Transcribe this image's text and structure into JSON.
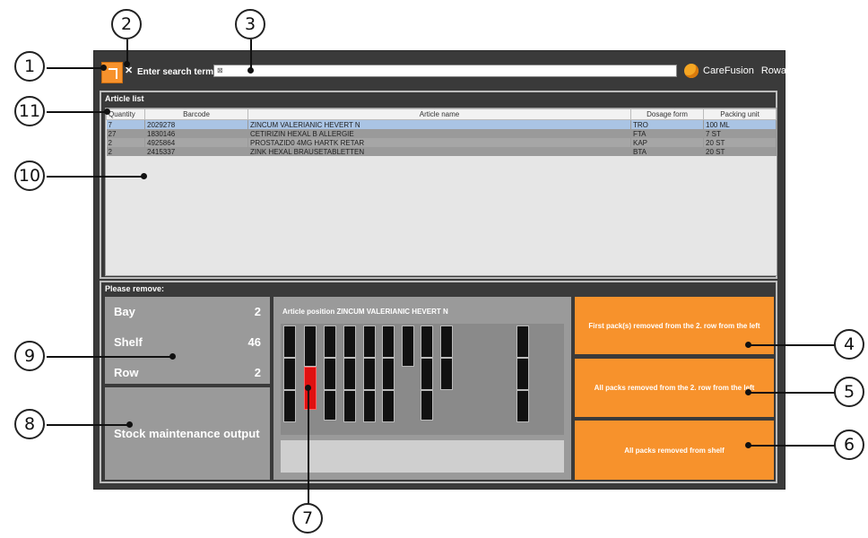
{
  "callouts": [
    "1",
    "2",
    "3",
    "4",
    "5",
    "6",
    "7",
    "8",
    "9",
    "10",
    "11"
  ],
  "toolbar": {
    "close_label": "✕",
    "search_label": "Enter search term:",
    "search_value": "⊠",
    "brand_name": "CareFusion",
    "brand_sub": "Rowa"
  },
  "article_list": {
    "title": "Article list",
    "columns": [
      "Quantity",
      "Barcode",
      "Article name",
      "Dosage form",
      "Packing unit"
    ],
    "rows": [
      [
        "7",
        "2029278",
        "ZINCUM VALERIANIC HEVERT N",
        "TRO",
        "100 ML"
      ],
      [
        "27",
        "1830146",
        "CETIRIZIN HEXAL B ALLERGIE",
        "FTA",
        "7 ST"
      ],
      [
        "2",
        "4925864",
        "PROSTAZID0 4MG HARTK RETAR",
        "KAP",
        "20 ST"
      ],
      [
        "2",
        "2415337",
        "ZINK HEXAL BRAUSETABLETTEN",
        "BTA",
        "20 ST"
      ]
    ]
  },
  "removal": {
    "title": "Please remove:",
    "bay_label": "Bay",
    "bay_value": "2",
    "shelf_label": "Shelf",
    "shelf_value": "46",
    "row_label": "Row",
    "row_value": "2",
    "stock_button": "Stock maintenance output",
    "position_title": "Article position  ZINCUM VALERIANIC HEVERT N",
    "buttons": {
      "first_packs": "First pack(s) removed from the 2. row from the left",
      "all_packs_row": "All packs removed from the 2. row from the left",
      "all_packs_shelf": "All packs removed from shelf"
    }
  },
  "colors": {
    "accent": "#f7922c",
    "selection": "#aac4e4",
    "highlight": "#e01010"
  }
}
